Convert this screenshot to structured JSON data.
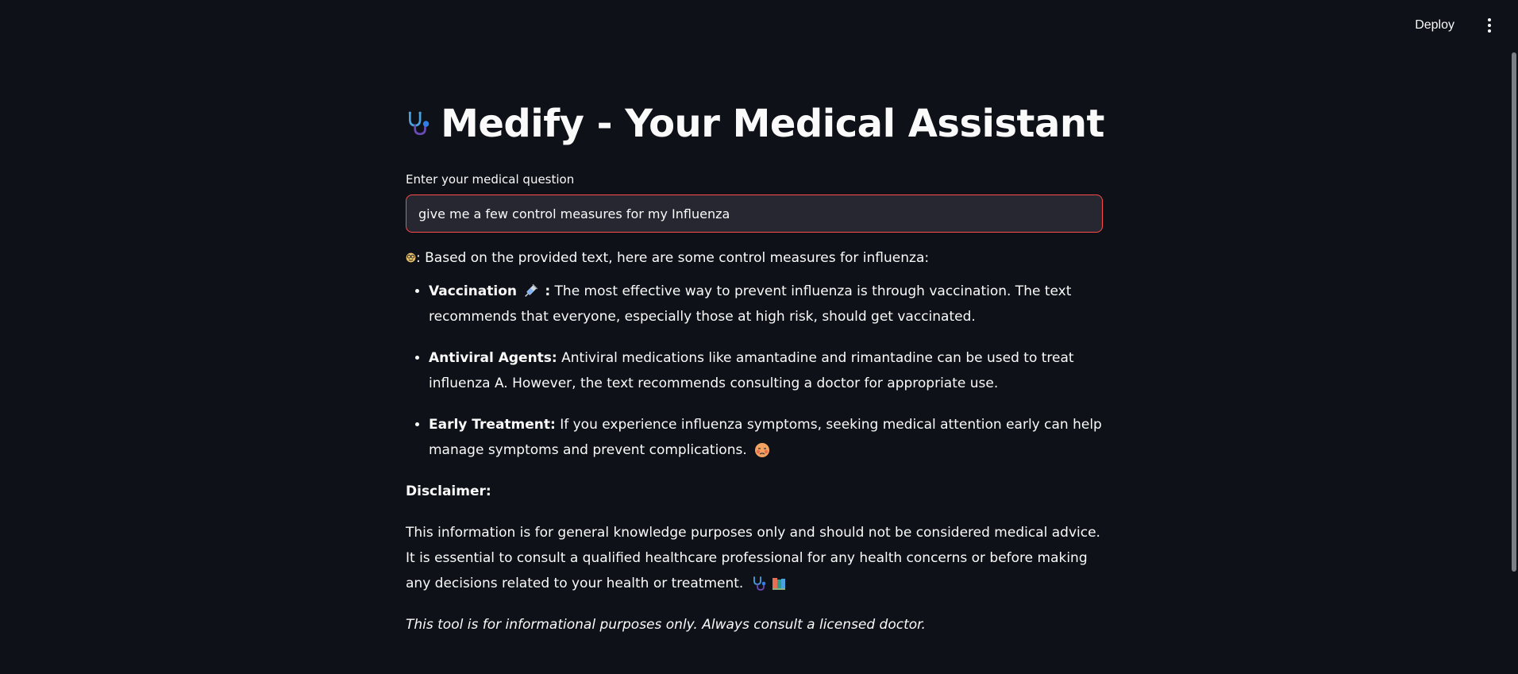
{
  "header": {
    "deploy_label": "Deploy"
  },
  "title": {
    "text": "Medify - Your Medical Assistant",
    "icon": "stethoscope-icon"
  },
  "question": {
    "label": "Enter your medical question",
    "value": "give me a few control measures for my Influenza"
  },
  "response": {
    "intro": ": Based on the provided text, here are some control measures for influenza:",
    "intro_icon": "nerd-face-icon",
    "items": [
      {
        "title": "Vaccination",
        "title_suffix": " :",
        "icon": "syringe-icon",
        "text": " The most effective way to prevent influenza is through vaccination. The text recommends that everyone, especially those at high risk, should get vaccinated."
      },
      {
        "title": "Antiviral Agents:",
        "text": " Antiviral medications like amantadine and rimantadine can be used to treat influenza A. However, the text recommends consulting a doctor for appropriate use."
      },
      {
        "title": "Early Treatment:",
        "text": " If you experience influenza symptoms, seeking medical attention early can help manage symptoms and prevent complications.",
        "icon": "sick-face-icon"
      }
    ],
    "disclaimer_title": "Disclaimer:",
    "disclaimer_text": "This information is for general knowledge purposes only and should not be considered medical advice. It is essential to consult a qualified healthcare professional for any health concerns or before making any decisions related to your health or treatment.",
    "disclaimer_icons": [
      "stethoscope-icon",
      "books-icon"
    ]
  },
  "footer_note": "This tool is for informational purposes only. Always consult a licensed doctor.",
  "colors": {
    "background": "#0e1117",
    "input_bg": "#262730",
    "input_border": "#ff4b4b",
    "text": "#fafafa"
  }
}
